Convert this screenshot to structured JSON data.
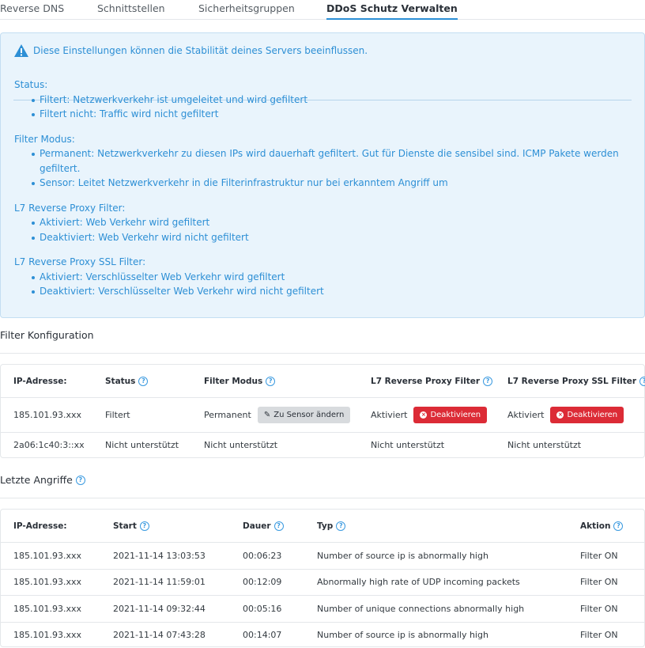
{
  "tabs": [
    {
      "label": "Reverse DNS"
    },
    {
      "label": "Schnittstellen"
    },
    {
      "label": "Sicherheitsgruppen"
    },
    {
      "label": "DDoS Schutz Verwalten"
    }
  ],
  "alert": {
    "warning": "Diese Einstellungen können die Stabilität deines Servers beeinflussen.",
    "sections": [
      {
        "title": "Status:",
        "items": [
          "Filtert: Netzwerkverkehr ist umgeleitet und wird gefiltert",
          "Filtert nicht: Traffic wird nicht gefiltert"
        ]
      },
      {
        "title": "Filter Modus:",
        "items": [
          "Permanent: Netzwerkverkehr zu diesen IPs wird dauerhaft gefiltert. Gut für Dienste die sensibel sind. ICMP Pakete werden gefiltert.",
          "Sensor: Leitet Netzwerkverkehr in die Filterinfrastruktur nur bei erkanntem Angriff um"
        ]
      },
      {
        "title": "L7 Reverse Proxy Filter:",
        "items": [
          "Aktiviert: Web Verkehr wird gefiltert",
          "Deaktiviert: Web Verkehr wird nicht gefiltert"
        ]
      },
      {
        "title": "L7 Reverse Proxy SSL Filter:",
        "items": [
          "Aktiviert: Verschlüsselter Web Verkehr wird gefiltert",
          "Deaktiviert: Verschlüsselter Web Verkehr wird nicht gefiltert"
        ]
      }
    ]
  },
  "filter_config": {
    "title": "Filter Konfiguration",
    "headers": [
      "IP-Adresse:",
      "Status",
      "Filter Modus",
      "L7 Reverse Proxy Filter",
      "L7 Reverse Proxy SSL Filter"
    ],
    "rows": [
      {
        "ip": "185.101.93.xxx",
        "status": "Filtert",
        "mode": "Permanent",
        "mode_button": "Zu Sensor ändern",
        "l7": "Aktiviert",
        "l7_button": "Deaktivieren",
        "l7ssl": "Aktiviert",
        "l7ssl_button": "Deaktivieren"
      },
      {
        "ip": "2a06:1c40:3::xx",
        "status": "Nicht unterstützt",
        "mode": "Nicht unterstützt",
        "l7": "Nicht unterstützt",
        "l7ssl": "Nicht unterstützt"
      }
    ]
  },
  "attacks": {
    "title": "Letzte Angriffe",
    "headers": [
      "IP-Adresse:",
      "Start",
      "Dauer",
      "Typ",
      "Aktion"
    ],
    "rows": [
      {
        "ip": "185.101.93.xxx",
        "start": "2021-11-14 13:03:53",
        "duration": "00:06:23",
        "type": "Number of source ip is abnormally high",
        "action": "Filter ON"
      },
      {
        "ip": "185.101.93.xxx",
        "start": "2021-11-14 11:59:01",
        "duration": "00:12:09",
        "type": "Abnormally high rate of UDP incoming packets",
        "action": "Filter ON"
      },
      {
        "ip": "185.101.93.xxx",
        "start": "2021-11-14 09:32:44",
        "duration": "00:05:16",
        "type": "Number of unique connections abnormally high",
        "action": "Filter ON"
      },
      {
        "ip": "185.101.93.xxx",
        "start": "2021-11-14 07:43:28",
        "duration": "00:14:07",
        "type": "Number of source ip is abnormally high",
        "action": "Filter ON"
      }
    ]
  },
  "colors": {
    "accent": "#2b8fd6",
    "danger": "#dc2b36",
    "info_bg": "#e9f4fc"
  },
  "icons": {
    "warning": "warning-triangle-icon",
    "help": "question-circle-icon",
    "edit": "pencil-icon",
    "close": "x-circle-icon"
  }
}
